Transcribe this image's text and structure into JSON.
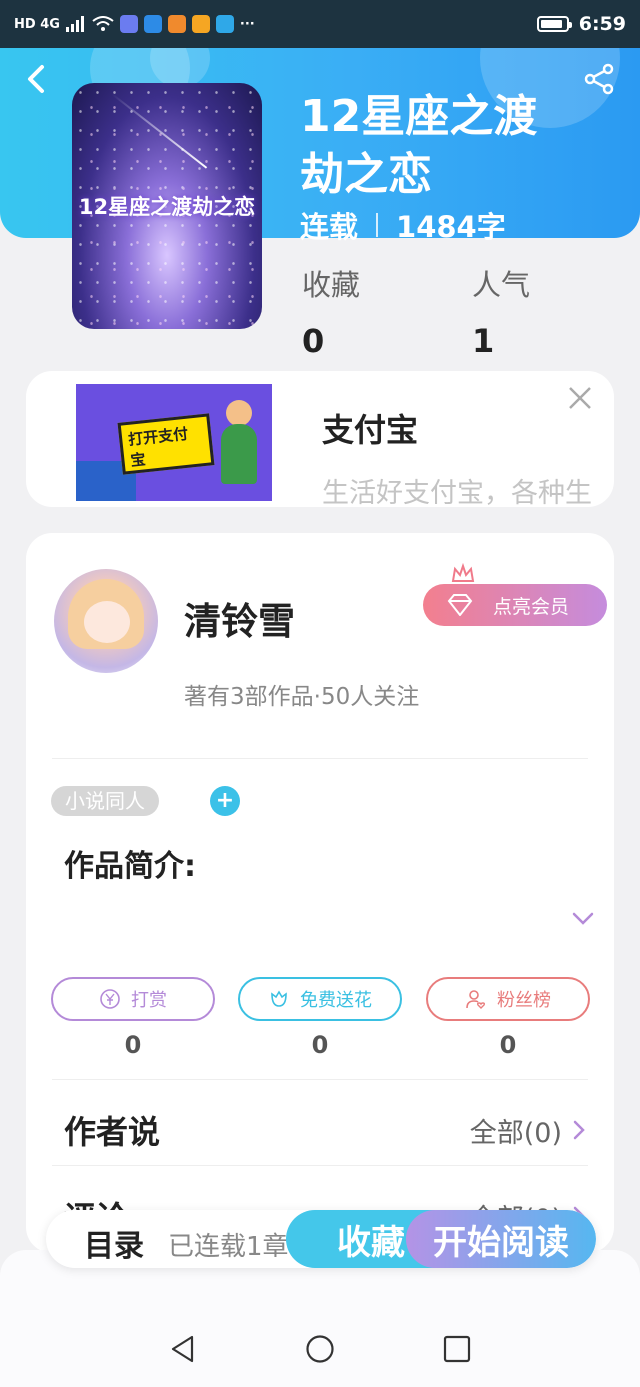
{
  "status_bar": {
    "left_text": "HD 4G",
    "time": "6:59",
    "more": "···"
  },
  "book": {
    "cover_title": "12星座之渡劫之恋",
    "title_line1": "12星座之渡",
    "title_line2": "劫之恋",
    "status": "连载",
    "word_count": "1484字",
    "stats": [
      {
        "label": "收藏",
        "value": "0"
      },
      {
        "label": "人气",
        "value": "1"
      }
    ]
  },
  "ad": {
    "image_sign_text": "打开支付宝",
    "name": "支付宝",
    "description": "生活好支付宝，各种生"
  },
  "author": {
    "name": "清铃雪",
    "vip_label": "点亮会员",
    "subline": "著有3部作品·50人关注"
  },
  "work": {
    "tag": "小说同人",
    "tag_add": "+",
    "intro_label": "作品简介:"
  },
  "actions": [
    {
      "label": "打赏",
      "count": "0",
      "color": "#b48ad8"
    },
    {
      "label": "免费送花",
      "count": "0",
      "color": "#3ac0e2"
    },
    {
      "label": "粉丝榜",
      "count": "0",
      "color": "#e87c7c"
    }
  ],
  "sections": {
    "author_says": {
      "label": "作者说",
      "more": "全部(0)"
    },
    "comments": {
      "label": "评论",
      "more": "全部(0)"
    }
  },
  "bottom_bar": {
    "directory": "目录",
    "progress": "已连载1章",
    "favorite": "收藏",
    "start_reading": "开始阅读"
  }
}
